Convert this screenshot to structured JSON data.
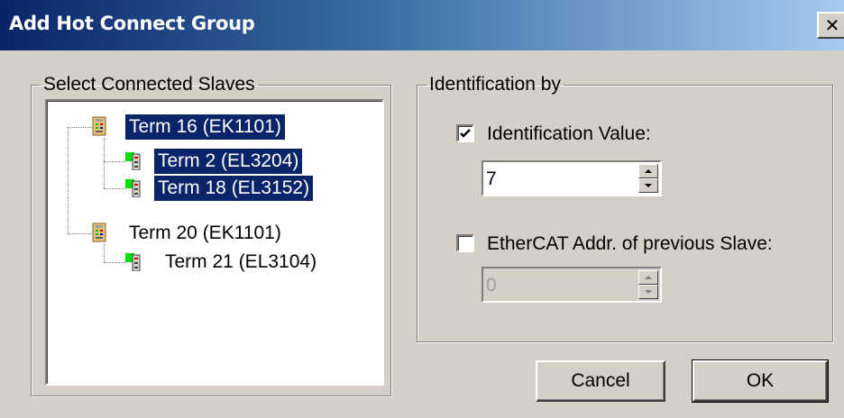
{
  "window": {
    "title": "Add Hot Connect Group"
  },
  "slaves_group": {
    "legend": "Select Connected Slaves",
    "tree": [
      {
        "label": "Term 16 (EK1101)",
        "selected": true,
        "level": 0
      },
      {
        "label": "Term 2 (EL3204)",
        "selected": true,
        "level": 1
      },
      {
        "label": "Term 18 (EL3152)",
        "selected": true,
        "level": 1
      },
      {
        "label": "Term 20 (EK1101)",
        "selected": false,
        "level": 0
      },
      {
        "label": "Term 21 (EL3104)",
        "selected": false,
        "level": 1
      }
    ]
  },
  "identification": {
    "legend": "Identification by",
    "identification_value": {
      "label": "Identification Value:",
      "checked": true,
      "value": "7",
      "enabled": true
    },
    "ethercat_addr": {
      "label": "EtherCAT Addr. of previous Slave:",
      "checked": false,
      "value": "0",
      "enabled": false
    }
  },
  "buttons": {
    "cancel": "Cancel",
    "ok": "OK"
  },
  "colors": {
    "title_gradient_start": "#0a246a",
    "title_gradient_end": "#a6caf0",
    "dialog_bg": "#d4d0c8",
    "selection_bg": "#0a246a",
    "terminal_led_green": "#00e000"
  }
}
